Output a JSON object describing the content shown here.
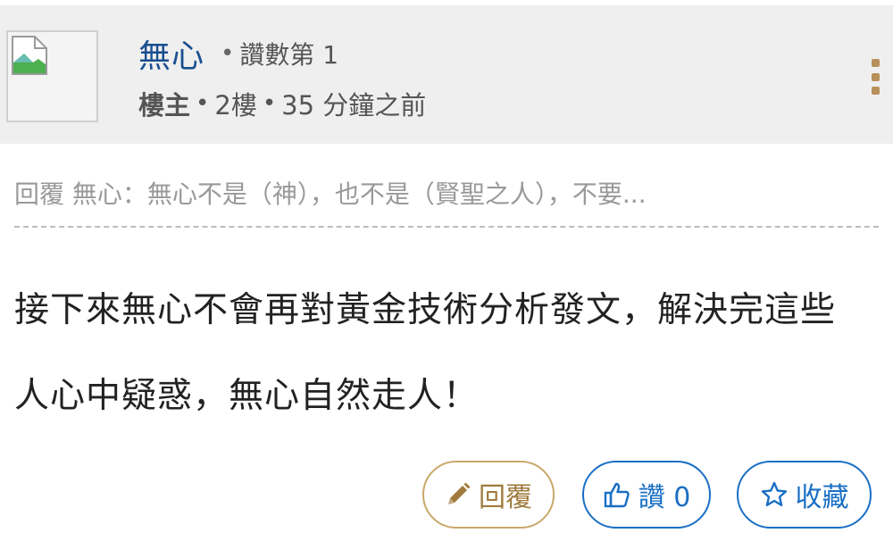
{
  "post": {
    "author": "無心",
    "likes_rank": "讚數第 1",
    "op_badge": "樓主",
    "floor": "2樓",
    "time": "35 分鐘之前"
  },
  "quote": {
    "text": "回覆 無心：無心不是（神），也不是（賢聖之人），不要..."
  },
  "content": {
    "line1": "接下來無心不會再對黃金技術分析發文，解決完這些",
    "line2": "人心中疑惑，無心自然走人！"
  },
  "actions": {
    "reply_label": "回覆",
    "like_label": "讚 0",
    "favorite_label": "收藏"
  },
  "colors": {
    "author_name": "#1a4f8f",
    "accent_gold": "#c9a86a",
    "accent_blue": "#1a6fc4",
    "header_bg": "#efefef"
  },
  "icons": {
    "avatar": "broken-image-icon",
    "more": "more-vertical-icon",
    "reply": "pencil-icon",
    "like": "thumbs-up-icon",
    "favorite": "star-outline-icon"
  }
}
